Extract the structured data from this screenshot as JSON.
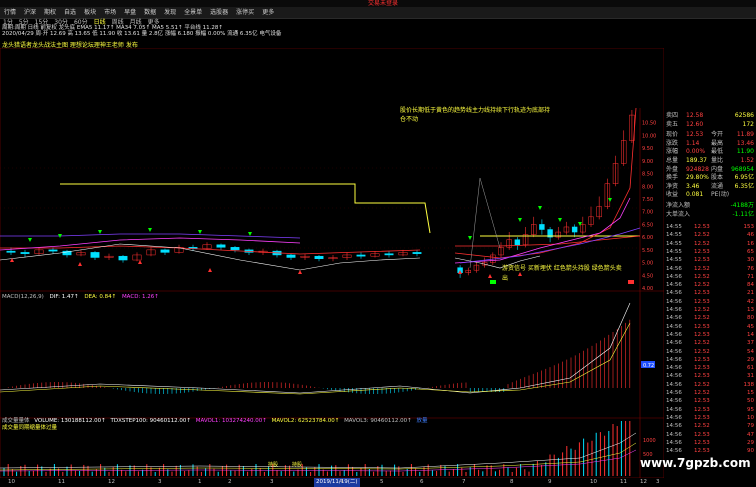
{
  "title_right": "交易未登录",
  "menu": [
    "行情",
    "沪深",
    "期权",
    "自选",
    "板块",
    "市场",
    "早盘",
    "数据",
    "发现",
    "全景单",
    "选股器",
    "涨停买",
    "更多"
  ],
  "periods": [
    "1分",
    "5分",
    "15分",
    "30分",
    "60分",
    "日线",
    "周线",
    "月线",
    "更多"
  ],
  "active_period": "日线",
  "info1": "周期:周期 日线 前复权   龙头底 EMA5 11.17↑ MA34 7.05↑ MA5 5.51↑ 平台线 11.28↑",
  "info2": "2020/04/29 周·开 12.69 高 13.65 低 11.90 收 13.61 量 2.8亿 涨幅 6.180 振幅 0.00% 流通 6.35亿 电气设备",
  "subhead": "龙头猎语者龙头战法主图 理想论坛理神王老师 发布",
  "annot1": "股价长期低于黄色的趋势线主力线持续下行轨迹为底部持仓不动",
  "annot2": "游资信号 买新埋伏 红色箭头持股 绿色箭头卖出",
  "macd_title": {
    "name": "MACD(12,26,9)",
    "dif": "DIF: 1.47↑",
    "dea": "DEA: 0.84↑",
    "macd": "MACD: 1.26↑"
  },
  "vol_title": {
    "name": "成交量量体",
    "volume": "VOLUME: 130188112.00↑",
    "tdx": "TDXSTEP100: 90460112.00↑",
    "mavol1": "MAVOL1: 103274240.00↑",
    "mavol2": "MAVOL2: 62523784.00↑",
    "mavol3": "MAVOL3: 90460112.00↑",
    "tag": "放量"
  },
  "vol_sub": "成交量同期缩量体过量",
  "buy_labels": [
    "持股",
    "持股"
  ],
  "right_panel": {
    "quotes": [
      {
        "k": "卖四",
        "v1": "12.58",
        "c1": "#ff4040",
        "k2": "",
        "v2": "62586",
        "c2": "#ffff40"
      },
      {
        "k": "卖五",
        "v1": "12.60",
        "c1": "#ff4040",
        "k2": "",
        "v2": "172",
        "c2": "#ffff40"
      },
      {
        "k": "现价",
        "v1": "12.53",
        "c1": "#ff4040",
        "k2": "今开",
        "v2": "11.89",
        "c2": "#ff4040"
      },
      {
        "k": "涨跌",
        "v1": "1.14",
        "c1": "#ff4040",
        "k2": "最高",
        "v2": "13.46",
        "c2": "#ff4040"
      },
      {
        "k": "涨幅",
        "v1": "0.00%",
        "c1": "#ff4040",
        "k2": "最低",
        "v2": "11.90",
        "c2": "#00ff00"
      },
      {
        "k": "总量",
        "v1": "189.37",
        "c1": "#ffff40",
        "k2": "量比",
        "v2": "1.52",
        "c2": "#ff4040"
      },
      {
        "k": "外盘",
        "v1": "924828",
        "c1": "#ff4040",
        "k2": "内盘",
        "v2": "968954",
        "c2": "#00ff00"
      },
      {
        "k": "换手",
        "v1": "29.80%",
        "c1": "#ffff40",
        "k2": "股本",
        "v2": "6.95亿",
        "c2": "#ffff40"
      },
      {
        "k": "净资",
        "v1": "3.46",
        "c1": "#ffff40",
        "k2": "流通",
        "v2": "6.35亿",
        "c2": "#ffff40"
      },
      {
        "k": "收益",
        "v1": "0.081",
        "c1": "#ffff40",
        "k2": "PE(动)",
        "v2": "",
        "c2": "#ffff40"
      }
    ],
    "flows": [
      {
        "k": "净流入额",
        "v": "-4188万",
        "c": "#00ff00"
      },
      {
        "k": "大单流入",
        "v": "-1.11亿",
        "c": "#00ff00"
      }
    ],
    "ticks": [
      {
        "t": "14:55",
        "p": "12.53",
        "n": "153"
      },
      {
        "t": "14:55",
        "p": "12.52",
        "n": "46"
      },
      {
        "t": "14:55",
        "p": "12.52",
        "n": "16"
      },
      {
        "t": "14:55",
        "p": "12.53",
        "n": "65"
      },
      {
        "t": "14:55",
        "p": "12.53",
        "n": "30"
      },
      {
        "t": "14:56",
        "p": "12.52",
        "n": "76"
      },
      {
        "t": "14:56",
        "p": "12.52",
        "n": "71"
      },
      {
        "t": "14:56",
        "p": "12.52",
        "n": "84"
      },
      {
        "t": "14:56",
        "p": "12.53",
        "n": "21"
      },
      {
        "t": "14:56",
        "p": "12.53",
        "n": "42"
      },
      {
        "t": "14:56",
        "p": "12.52",
        "n": "13"
      },
      {
        "t": "14:56",
        "p": "12.52",
        "n": "80"
      },
      {
        "t": "14:56",
        "p": "12.53",
        "n": "45"
      },
      {
        "t": "14:56",
        "p": "12.53",
        "n": "14"
      },
      {
        "t": "14:56",
        "p": "12.52",
        "n": "37"
      },
      {
        "t": "14:56",
        "p": "12.52",
        "n": "54"
      },
      {
        "t": "14:56",
        "p": "12.53",
        "n": "29"
      },
      {
        "t": "14:56",
        "p": "12.53",
        "n": "61"
      },
      {
        "t": "14:56",
        "p": "12.53",
        "n": "31"
      },
      {
        "t": "14:56",
        "p": "12.52",
        "n": "138"
      },
      {
        "t": "14:56",
        "p": "12.52",
        "n": "15"
      },
      {
        "t": "14:56",
        "p": "12.53",
        "n": "50"
      },
      {
        "t": "14:56",
        "p": "12.53",
        "n": "95"
      },
      {
        "t": "14:56",
        "p": "12.53",
        "n": "10"
      },
      {
        "t": "14:56",
        "p": "12.52",
        "n": "79"
      },
      {
        "t": "14:56",
        "p": "12.53",
        "n": "47"
      },
      {
        "t": "14:56",
        "p": "12.53",
        "n": "29"
      },
      {
        "t": "14:56",
        "p": "12.53",
        "n": "90"
      }
    ]
  },
  "axis_right": [
    "10.50",
    "10.00",
    "9.50",
    "9.00",
    "8.50",
    "8.00",
    "7.50",
    "7.00",
    "6.50",
    "6.00",
    "5.50",
    "5.00",
    "4.50",
    "4.00"
  ],
  "macd_axis_tag": "0.72",
  "dates": [
    "10",
    "11",
    "12",
    "3",
    "1",
    "2",
    "3",
    "4",
    "5",
    "6",
    "7",
    "8",
    "9",
    "10",
    "11",
    "12",
    "3"
  ],
  "date_highlight": "2019/11/19(二)",
  "watermark": "www.7gpzb.com",
  "colors": {
    "up": "#ff3030",
    "down": "#00e0ff",
    "yellow": "#ffff40",
    "white": "#ffffff",
    "magenta": "#ff40ff",
    "green": "#00ff00"
  },
  "chart_data": [
    {
      "type": "candlestick",
      "ylim": [
        4.0,
        11.0
      ],
      "candles_left": [
        [
          5.45,
          5.4,
          5.3,
          5.6
        ],
        [
          5.4,
          5.35,
          5.2,
          5.5
        ],
        [
          5.35,
          5.5,
          5.3,
          5.6
        ],
        [
          5.5,
          5.45,
          5.35,
          5.6
        ],
        [
          5.45,
          5.3,
          5.2,
          5.5
        ],
        [
          5.3,
          5.4,
          5.25,
          5.5
        ],
        [
          5.4,
          5.2,
          5.1,
          5.45
        ],
        [
          5.2,
          5.25,
          5.1,
          5.35
        ],
        [
          5.25,
          5.1,
          5.0,
          5.3
        ],
        [
          5.1,
          5.3,
          5.05,
          5.4
        ],
        [
          5.3,
          5.5,
          5.25,
          5.6
        ],
        [
          5.5,
          5.4,
          5.3,
          5.55
        ],
        [
          5.4,
          5.6,
          5.35,
          5.7
        ],
        [
          5.6,
          5.55,
          5.45,
          5.7
        ],
        [
          5.55,
          5.7,
          5.5,
          5.8
        ],
        [
          5.7,
          5.6,
          5.5,
          5.75
        ],
        [
          5.6,
          5.5,
          5.4,
          5.65
        ],
        [
          5.5,
          5.4,
          5.3,
          5.55
        ],
        [
          5.4,
          5.45,
          5.3,
          5.55
        ],
        [
          5.45,
          5.3,
          5.2,
          5.5
        ],
        [
          5.3,
          5.2,
          5.1,
          5.35
        ],
        [
          5.2,
          5.25,
          5.1,
          5.35
        ],
        [
          5.25,
          5.15,
          5.05,
          5.3
        ],
        [
          5.15,
          5.2,
          5.05,
          5.3
        ],
        [
          5.2,
          5.3,
          5.1,
          5.4
        ],
        [
          5.3,
          5.25,
          5.15,
          5.4
        ],
        [
          5.25,
          5.35,
          5.2,
          5.45
        ],
        [
          5.35,
          5.3,
          5.2,
          5.45
        ],
        [
          5.3,
          5.4,
          5.25,
          5.5
        ],
        [
          5.4,
          5.35,
          5.25,
          5.5
        ]
      ],
      "candles_right": [
        [
          4.8,
          4.6,
          4.4,
          4.9
        ],
        [
          4.6,
          4.7,
          4.5,
          4.8
        ],
        [
          4.7,
          4.9,
          4.6,
          5.0
        ],
        [
          4.9,
          5.0,
          4.8,
          5.2
        ],
        [
          5.0,
          5.3,
          4.9,
          5.4
        ],
        [
          5.3,
          5.6,
          5.2,
          5.8
        ],
        [
          5.6,
          5.9,
          5.5,
          6.2
        ],
        [
          5.9,
          5.7,
          5.5,
          6.0
        ],
        [
          5.7,
          6.1,
          5.6,
          6.4
        ],
        [
          6.1,
          6.5,
          6.0,
          6.8
        ],
        [
          6.5,
          6.3,
          6.1,
          6.7
        ],
        [
          6.3,
          6.0,
          5.8,
          6.4
        ],
        [
          6.0,
          6.2,
          5.9,
          6.4
        ],
        [
          6.2,
          6.4,
          6.1,
          6.6
        ],
        [
          6.4,
          6.2,
          6.0,
          6.5
        ],
        [
          6.2,
          6.5,
          6.1,
          6.8
        ],
        [
          6.5,
          6.8,
          6.4,
          7.2
        ],
        [
          6.8,
          7.2,
          6.7,
          7.6
        ],
        [
          7.2,
          8.1,
          7.1,
          8.3
        ],
        [
          8.1,
          8.9,
          8.0,
          9.2
        ],
        [
          8.9,
          9.8,
          8.8,
          10.2
        ],
        [
          9.8,
          10.8,
          9.7,
          11.0
        ]
      ],
      "yellow_line": [
        [
          355,
          185
        ],
        [
          355,
          222
        ],
        [
          425,
          222
        ],
        [
          425,
          232
        ]
      ],
      "yellow_line2": [
        [
          480,
          242
        ],
        [
          640,
          242
        ]
      ]
    },
    {
      "type": "bar",
      "name": "MACD",
      "ylim": [
        -1,
        2
      ]
    },
    {
      "type": "bar",
      "name": "VOLUME"
    }
  ]
}
